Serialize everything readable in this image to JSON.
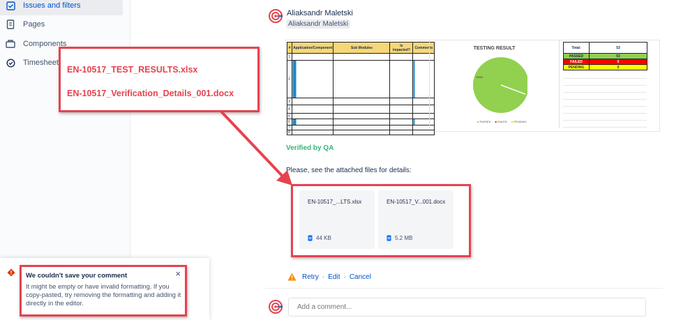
{
  "sidebar": {
    "items": [
      {
        "label": "Issues and filters",
        "icon": "issues-icon",
        "active": true
      },
      {
        "label": "Pages",
        "icon": "pages-icon"
      },
      {
        "label": "Components",
        "icon": "components-icon"
      },
      {
        "label": "Timesheet",
        "icon": "timesheet-icon"
      }
    ]
  },
  "comment": {
    "author": "Aliaksandr Maletski",
    "author_tag": "Aliaksandr Maletski",
    "verified_text": "Verified by QA",
    "details_text": "Please, see the attached files for details:",
    "attachments": [
      {
        "name": "EN-10517_...LTS.xlsx",
        "size": "44 KB"
      },
      {
        "name": "EN-10517_V...001.docx",
        "size": "5.2 MB"
      }
    ],
    "actions": {
      "retry": "Retry",
      "edit": "Edit",
      "cancel": "Cancel",
      "sep": "·"
    }
  },
  "callout": {
    "file1": "EN-10517_TEST_RESULTS.xlsx",
    "file2": "EN-10517_Verification_Details_001.docx"
  },
  "sheet": {
    "headers": [
      "#",
      "Application/Component",
      "Sub Modules",
      "Is impacted?",
      "Comments"
    ],
    "row_numbers": [
      "1",
      "2",
      "3",
      "4",
      "5",
      "6",
      "7",
      "8"
    ],
    "chart_title": "TESTING RESULT",
    "pie_label": "100%",
    "legend": [
      "PASSED",
      "FAILED",
      "PENDING"
    ],
    "totals": [
      {
        "label": "Total:",
        "value": "53"
      },
      {
        "label": "PASSED",
        "value": "53"
      },
      {
        "label": "FAILED",
        "value": "0"
      },
      {
        "label": "PENDING",
        "value": "0"
      }
    ]
  },
  "error": {
    "title": "We couldn't save your comment",
    "body": "It might be empty or have invalid formatting. If you copy-pasted, try removing the formatting and adding it directly in the editor.",
    "close": "×"
  },
  "composer": {
    "placeholder": "Add a comment..."
  },
  "colors": {
    "accent": "#0052cc",
    "verified": "#36b37e",
    "callout_text": "#e5434f",
    "warning": "#ff8b00",
    "error": "#de350b",
    "passed": "#92d050",
    "failed": "#ff0000",
    "pending": "#ffff00"
  }
}
